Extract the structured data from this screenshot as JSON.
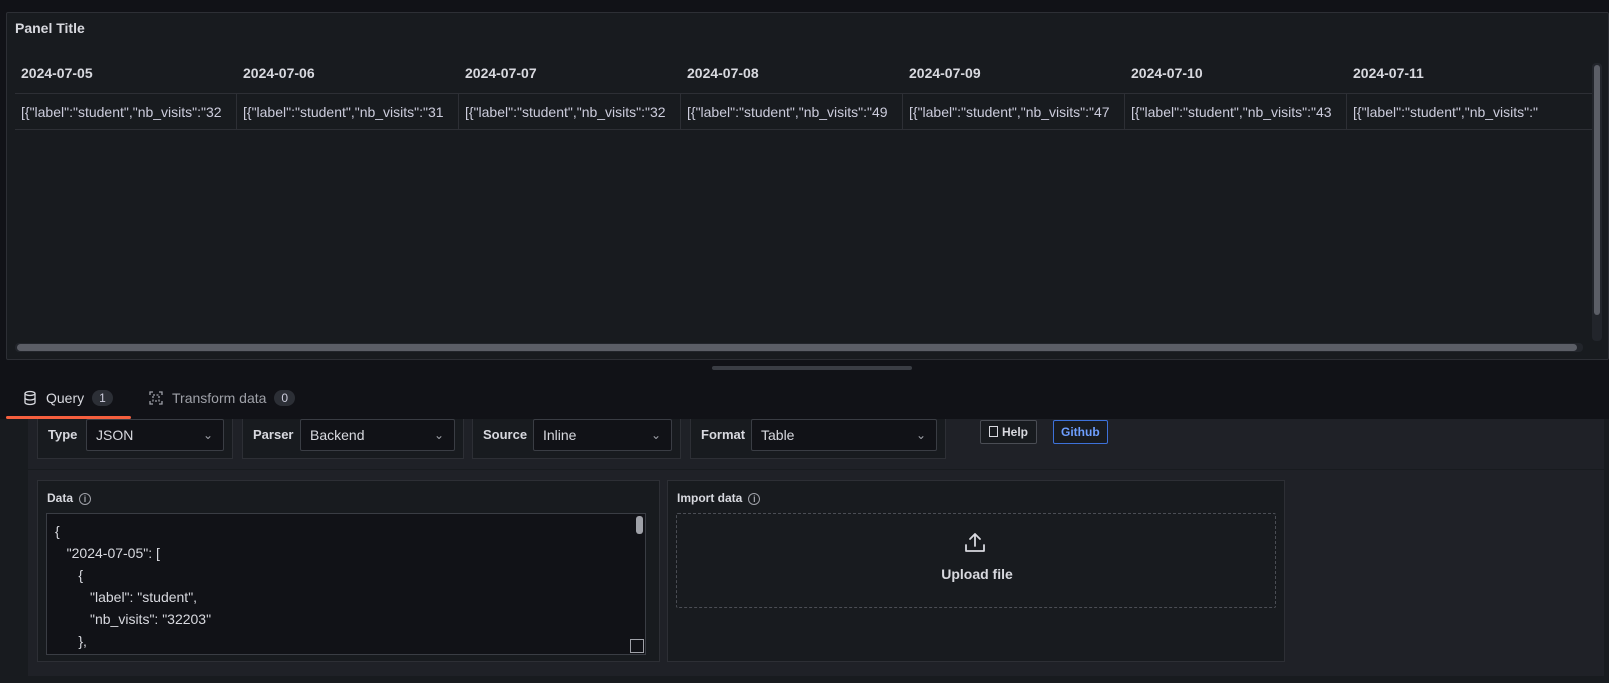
{
  "panel": {
    "title": "Panel Title",
    "columns": [
      "2024-07-05",
      "2024-07-06",
      "2024-07-07",
      "2024-07-08",
      "2024-07-09",
      "2024-07-10",
      "2024-07-11"
    ],
    "row": [
      "[{\"label\":\"student\",\"nb_visits\":\"32",
      "[{\"label\":\"student\",\"nb_visits\":\"31",
      "[{\"label\":\"student\",\"nb_visits\":\"32",
      "[{\"label\":\"student\",\"nb_visits\":\"49",
      "[{\"label\":\"student\",\"nb_visits\":\"47",
      "[{\"label\":\"student\",\"nb_visits\":\"43",
      "[{\"label\":\"student\",\"nb_visits\":\""
    ]
  },
  "tabs": {
    "query": {
      "label": "Query",
      "count": "1"
    },
    "transform": {
      "label": "Transform data",
      "count": "0"
    }
  },
  "fields": {
    "type": {
      "label": "Type",
      "value": "JSON"
    },
    "parser": {
      "label": "Parser",
      "value": "Backend"
    },
    "source": {
      "label": "Source",
      "value": "Inline"
    },
    "format": {
      "label": "Format",
      "value": "Table"
    }
  },
  "buttons": {
    "help": "Help",
    "github": "Github"
  },
  "data_section": {
    "label": "Data",
    "code": [
      "{",
      "   \"2024-07-05\": [",
      "      {",
      "         \"label\": \"student\",",
      "         \"nb_visits\": \"32203\"",
      "      },",
      "      {"
    ]
  },
  "import_section": {
    "label": "Import data",
    "upload": "Upload file"
  },
  "colors": {
    "accent": "#f55f3e",
    "link": "#6e9fff",
    "background": "#111217",
    "panel": "#181b1f"
  }
}
